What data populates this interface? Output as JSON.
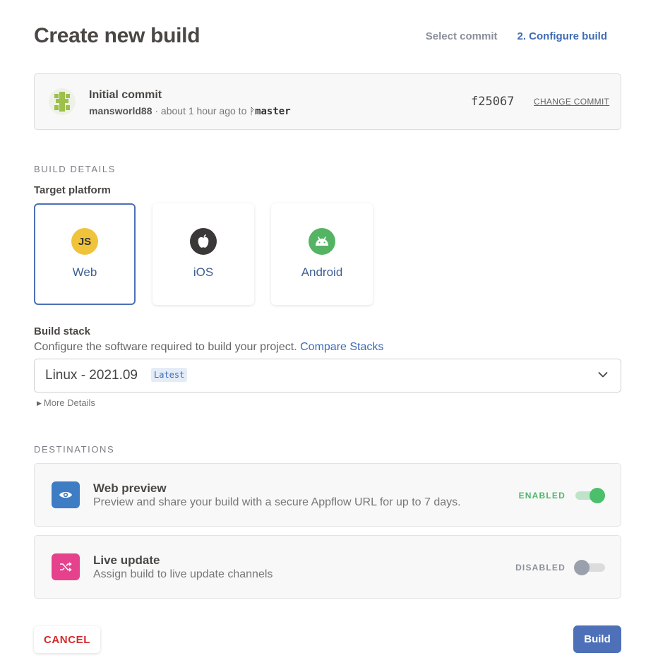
{
  "header": {
    "title": "Create new build",
    "steps": [
      {
        "label": "Select commit"
      },
      {
        "label": "2. Configure build"
      }
    ]
  },
  "commit": {
    "message": "Initial commit",
    "author": "mansworld88",
    "meta_text": " · about 1 hour ago to ",
    "branch": "master",
    "sha": "f25067",
    "change_label": "CHANGE COMMIT"
  },
  "build_details": {
    "section_label": "BUILD DETAILS",
    "target_label": "Target platform",
    "platforms": [
      {
        "name": "Web",
        "icon": "js-icon",
        "badge": "JS",
        "color": "#f0c43a",
        "selected": true
      },
      {
        "name": "iOS",
        "icon": "apple-icon",
        "color": "#3b3838",
        "selected": false
      },
      {
        "name": "Android",
        "icon": "android-icon",
        "color": "#55b464",
        "selected": false
      }
    ],
    "stack_label": "Build stack",
    "stack_desc": "Configure the software required to build your project.",
    "compare_link": "Compare Stacks",
    "stack_value": "Linux - 2021.09",
    "stack_badge": "Latest",
    "more_details": "More Details"
  },
  "destinations": {
    "section_label": "DESTINATIONS",
    "items": [
      {
        "title": "Web preview",
        "description": "Preview and share your build with a secure Appflow URL for up to 7 days.",
        "status": "ENABLED",
        "enabled": true,
        "icon": "eye-icon",
        "color": "#3e7cc4"
      },
      {
        "title": "Live update",
        "description": "Assign build to live update channels",
        "status": "DISABLED",
        "enabled": false,
        "icon": "shuffle-icon",
        "color": "#e5418c"
      }
    ]
  },
  "actions": {
    "cancel_label": "CANCEL",
    "build_label": "Build"
  }
}
